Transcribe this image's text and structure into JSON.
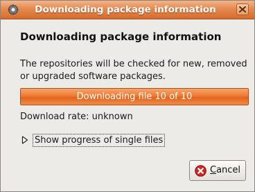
{
  "window": {
    "title": "Downloading package information",
    "app_icon": "package-manager-icon",
    "close_icon": "close-icon"
  },
  "dialog": {
    "heading": "Downloading package information",
    "description": "The repositories will be checked for new, removed or upgraded software packages.",
    "progress": {
      "text": "Downloading file 10 of 10",
      "fraction": 1.0
    },
    "download_rate": "Download rate: unknown",
    "expander_label": "Show progress of single files",
    "cancel_mnemonic": "C",
    "cancel_rest": "ancel"
  },
  "colors": {
    "accent": "#e3641c",
    "title_text": "#ffffff"
  }
}
